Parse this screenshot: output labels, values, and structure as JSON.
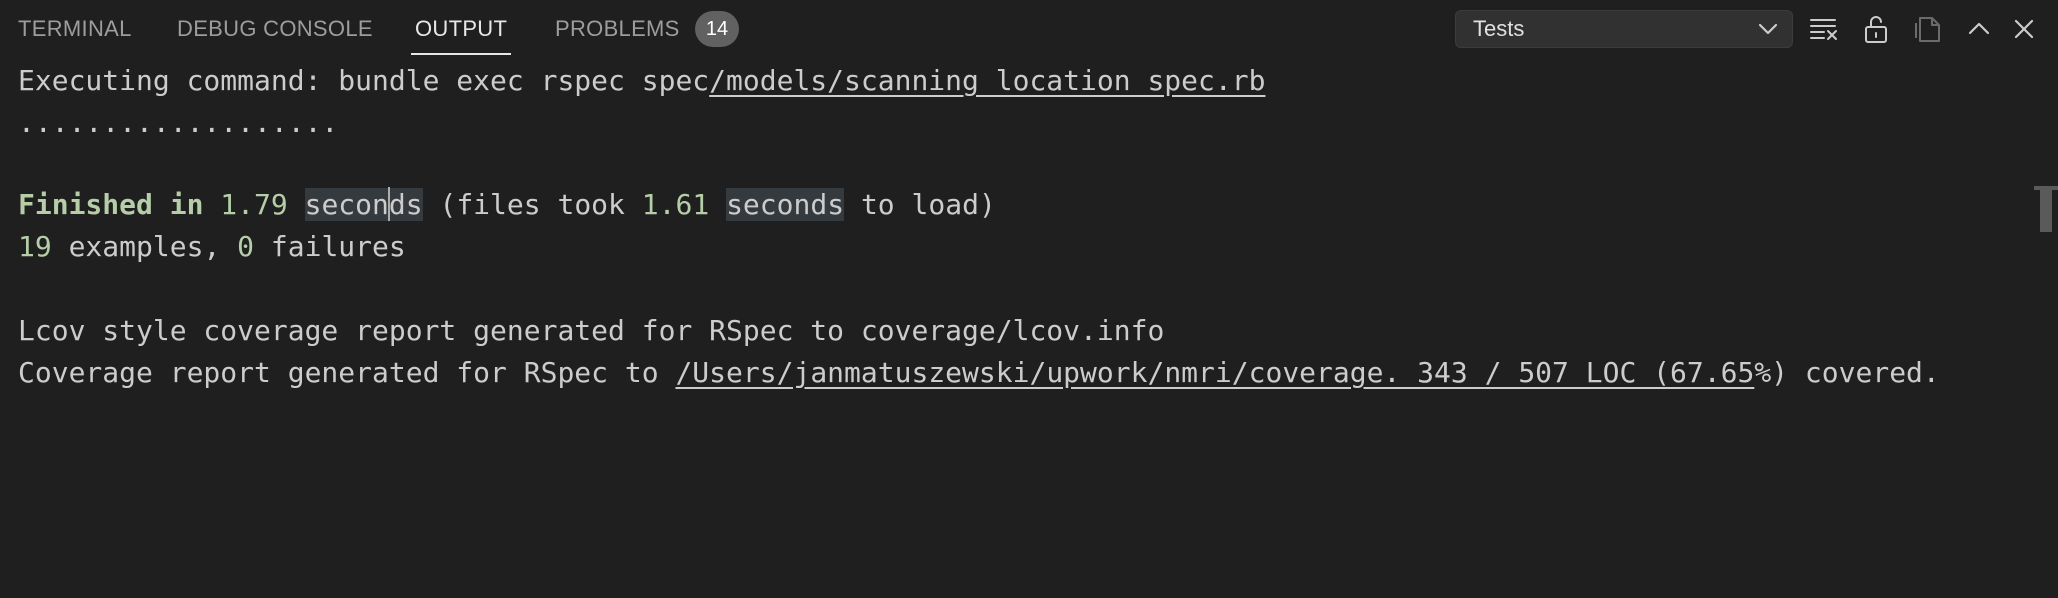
{
  "tabs": [
    {
      "label": "TERMINAL",
      "active": false
    },
    {
      "label": "DEBUG CONSOLE",
      "active": false
    },
    {
      "label": "OUTPUT",
      "active": true
    },
    {
      "label": "PROBLEMS",
      "active": false
    }
  ],
  "problems_count": "14",
  "output_channel": {
    "selected": "Tests"
  },
  "toolbar": {
    "icons": [
      "clear-output-icon",
      "lock-scroll-icon",
      "open-in-editor-icon",
      "maximize-panel-icon",
      "close-panel-icon"
    ]
  },
  "output": {
    "line1_prefix": "Executing command: bundle exec rspec spec",
    "line1_path": "/models/scanning_location_spec.rb",
    "line2": "...................",
    "line3": {
      "finished": "Finished in",
      "time": "1.79",
      "sec_a": "secon",
      "sec_b": "ds",
      "mid": "(files took",
      "load_time": "1.61",
      "sec2": "seconds",
      "end": "to load)"
    },
    "line4": {
      "examples_count": "19",
      "examples_label": "examples,",
      "failures_count": "0",
      "failures_label": "failures"
    },
    "line5": "Lcov style coverage report generated for RSpec to coverage/lcov.info",
    "line6": {
      "prefix": "Coverage report generated for RSpec to ",
      "link": "/Users/janmatuszewski/upwork/nmri/coverage. 343 / 507 LOC (67.65",
      "suffix": "%) covered."
    }
  },
  "colors": {
    "background": "#1f1f1f",
    "text": "#cccccc",
    "number": "#b5cea8",
    "active_tab": "#e7e7e7",
    "inactive_tab": "#9d9d9d",
    "badge": "#616161"
  }
}
